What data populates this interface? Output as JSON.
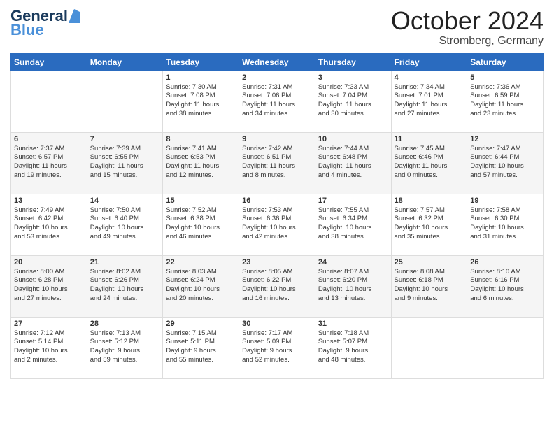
{
  "header": {
    "logo_general": "General",
    "logo_blue": "Blue",
    "month_title": "October 2024",
    "location": "Stromberg, Germany"
  },
  "days_of_week": [
    "Sunday",
    "Monday",
    "Tuesday",
    "Wednesday",
    "Thursday",
    "Friday",
    "Saturday"
  ],
  "weeks": [
    [
      {
        "day": "",
        "info": ""
      },
      {
        "day": "",
        "info": ""
      },
      {
        "day": "1",
        "info": "Sunrise: 7:30 AM\nSunset: 7:08 PM\nDaylight: 11 hours\nand 38 minutes."
      },
      {
        "day": "2",
        "info": "Sunrise: 7:31 AM\nSunset: 7:06 PM\nDaylight: 11 hours\nand 34 minutes."
      },
      {
        "day": "3",
        "info": "Sunrise: 7:33 AM\nSunset: 7:04 PM\nDaylight: 11 hours\nand 30 minutes."
      },
      {
        "day": "4",
        "info": "Sunrise: 7:34 AM\nSunset: 7:01 PM\nDaylight: 11 hours\nand 27 minutes."
      },
      {
        "day": "5",
        "info": "Sunrise: 7:36 AM\nSunset: 6:59 PM\nDaylight: 11 hours\nand 23 minutes."
      }
    ],
    [
      {
        "day": "6",
        "info": "Sunrise: 7:37 AM\nSunset: 6:57 PM\nDaylight: 11 hours\nand 19 minutes."
      },
      {
        "day": "7",
        "info": "Sunrise: 7:39 AM\nSunset: 6:55 PM\nDaylight: 11 hours\nand 15 minutes."
      },
      {
        "day": "8",
        "info": "Sunrise: 7:41 AM\nSunset: 6:53 PM\nDaylight: 11 hours\nand 12 minutes."
      },
      {
        "day": "9",
        "info": "Sunrise: 7:42 AM\nSunset: 6:51 PM\nDaylight: 11 hours\nand 8 minutes."
      },
      {
        "day": "10",
        "info": "Sunrise: 7:44 AM\nSunset: 6:48 PM\nDaylight: 11 hours\nand 4 minutes."
      },
      {
        "day": "11",
        "info": "Sunrise: 7:45 AM\nSunset: 6:46 PM\nDaylight: 11 hours\nand 0 minutes."
      },
      {
        "day": "12",
        "info": "Sunrise: 7:47 AM\nSunset: 6:44 PM\nDaylight: 10 hours\nand 57 minutes."
      }
    ],
    [
      {
        "day": "13",
        "info": "Sunrise: 7:49 AM\nSunset: 6:42 PM\nDaylight: 10 hours\nand 53 minutes."
      },
      {
        "day": "14",
        "info": "Sunrise: 7:50 AM\nSunset: 6:40 PM\nDaylight: 10 hours\nand 49 minutes."
      },
      {
        "day": "15",
        "info": "Sunrise: 7:52 AM\nSunset: 6:38 PM\nDaylight: 10 hours\nand 46 minutes."
      },
      {
        "day": "16",
        "info": "Sunrise: 7:53 AM\nSunset: 6:36 PM\nDaylight: 10 hours\nand 42 minutes."
      },
      {
        "day": "17",
        "info": "Sunrise: 7:55 AM\nSunset: 6:34 PM\nDaylight: 10 hours\nand 38 minutes."
      },
      {
        "day": "18",
        "info": "Sunrise: 7:57 AM\nSunset: 6:32 PM\nDaylight: 10 hours\nand 35 minutes."
      },
      {
        "day": "19",
        "info": "Sunrise: 7:58 AM\nSunset: 6:30 PM\nDaylight: 10 hours\nand 31 minutes."
      }
    ],
    [
      {
        "day": "20",
        "info": "Sunrise: 8:00 AM\nSunset: 6:28 PM\nDaylight: 10 hours\nand 27 minutes."
      },
      {
        "day": "21",
        "info": "Sunrise: 8:02 AM\nSunset: 6:26 PM\nDaylight: 10 hours\nand 24 minutes."
      },
      {
        "day": "22",
        "info": "Sunrise: 8:03 AM\nSunset: 6:24 PM\nDaylight: 10 hours\nand 20 minutes."
      },
      {
        "day": "23",
        "info": "Sunrise: 8:05 AM\nSunset: 6:22 PM\nDaylight: 10 hours\nand 16 minutes."
      },
      {
        "day": "24",
        "info": "Sunrise: 8:07 AM\nSunset: 6:20 PM\nDaylight: 10 hours\nand 13 minutes."
      },
      {
        "day": "25",
        "info": "Sunrise: 8:08 AM\nSunset: 6:18 PM\nDaylight: 10 hours\nand 9 minutes."
      },
      {
        "day": "26",
        "info": "Sunrise: 8:10 AM\nSunset: 6:16 PM\nDaylight: 10 hours\nand 6 minutes."
      }
    ],
    [
      {
        "day": "27",
        "info": "Sunrise: 7:12 AM\nSunset: 5:14 PM\nDaylight: 10 hours\nand 2 minutes."
      },
      {
        "day": "28",
        "info": "Sunrise: 7:13 AM\nSunset: 5:12 PM\nDaylight: 9 hours\nand 59 minutes."
      },
      {
        "day": "29",
        "info": "Sunrise: 7:15 AM\nSunset: 5:11 PM\nDaylight: 9 hours\nand 55 minutes."
      },
      {
        "day": "30",
        "info": "Sunrise: 7:17 AM\nSunset: 5:09 PM\nDaylight: 9 hours\nand 52 minutes."
      },
      {
        "day": "31",
        "info": "Sunrise: 7:18 AM\nSunset: 5:07 PM\nDaylight: 9 hours\nand 48 minutes."
      },
      {
        "day": "",
        "info": ""
      },
      {
        "day": "",
        "info": ""
      }
    ]
  ]
}
